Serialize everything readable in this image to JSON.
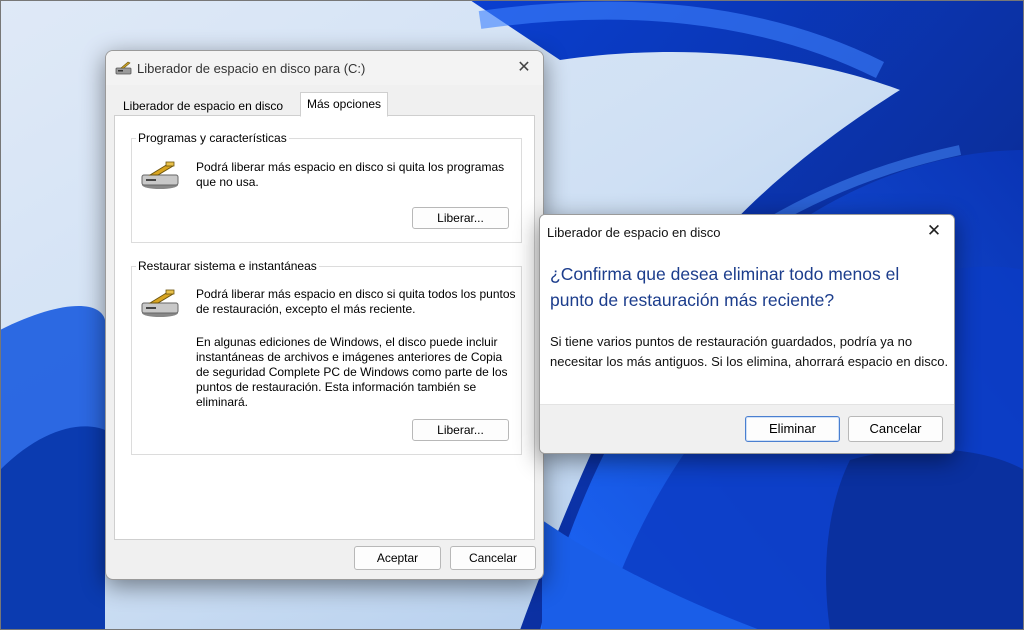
{
  "main_window": {
    "title": "Liberador de espacio en disco para  (C:)",
    "tabs": [
      {
        "label": "Liberador de espacio en disco"
      },
      {
        "label": "Más opciones"
      }
    ],
    "groups": [
      {
        "title": "Programas y características",
        "text": "Podrá liberar más espacio en disco si quita los programas que no usa.",
        "button": "Liberar..."
      },
      {
        "title": "Restaurar sistema e instantáneas",
        "text": "Podrá liberar más espacio en disco si quita todos los puntos de restauración, excepto el más reciente.",
        "text2": "En algunas ediciones de Windows, el disco puede incluir instantáneas de archivos e imágenes anteriores de Copia de seguridad Complete PC de Windows como parte de los puntos de restauración. Esta información también se eliminará.",
        "button": "Liberar..."
      }
    ],
    "ok_label": "Aceptar",
    "cancel_label": "Cancelar"
  },
  "dialog": {
    "title": "Liberador de espacio en disco",
    "heading": "¿Confirma que desea eliminar todo menos el punto de restauración más reciente?",
    "body": "Si tiene varios puntos de restauración guardados, podría ya no necesitar los más antiguos. Si los elimina, ahorrará espacio en disco.",
    "delete_label": "Eliminar",
    "cancel_label": "Cancelar"
  },
  "icons": {
    "window": "disk-cleanup-icon",
    "group": "disk-cleanup-icon",
    "close": "close-icon"
  },
  "colors": {
    "heading": "#1c3d8c",
    "wallpaper": "#0a2a8a",
    "primary_button_border": "#4a7fd0"
  }
}
